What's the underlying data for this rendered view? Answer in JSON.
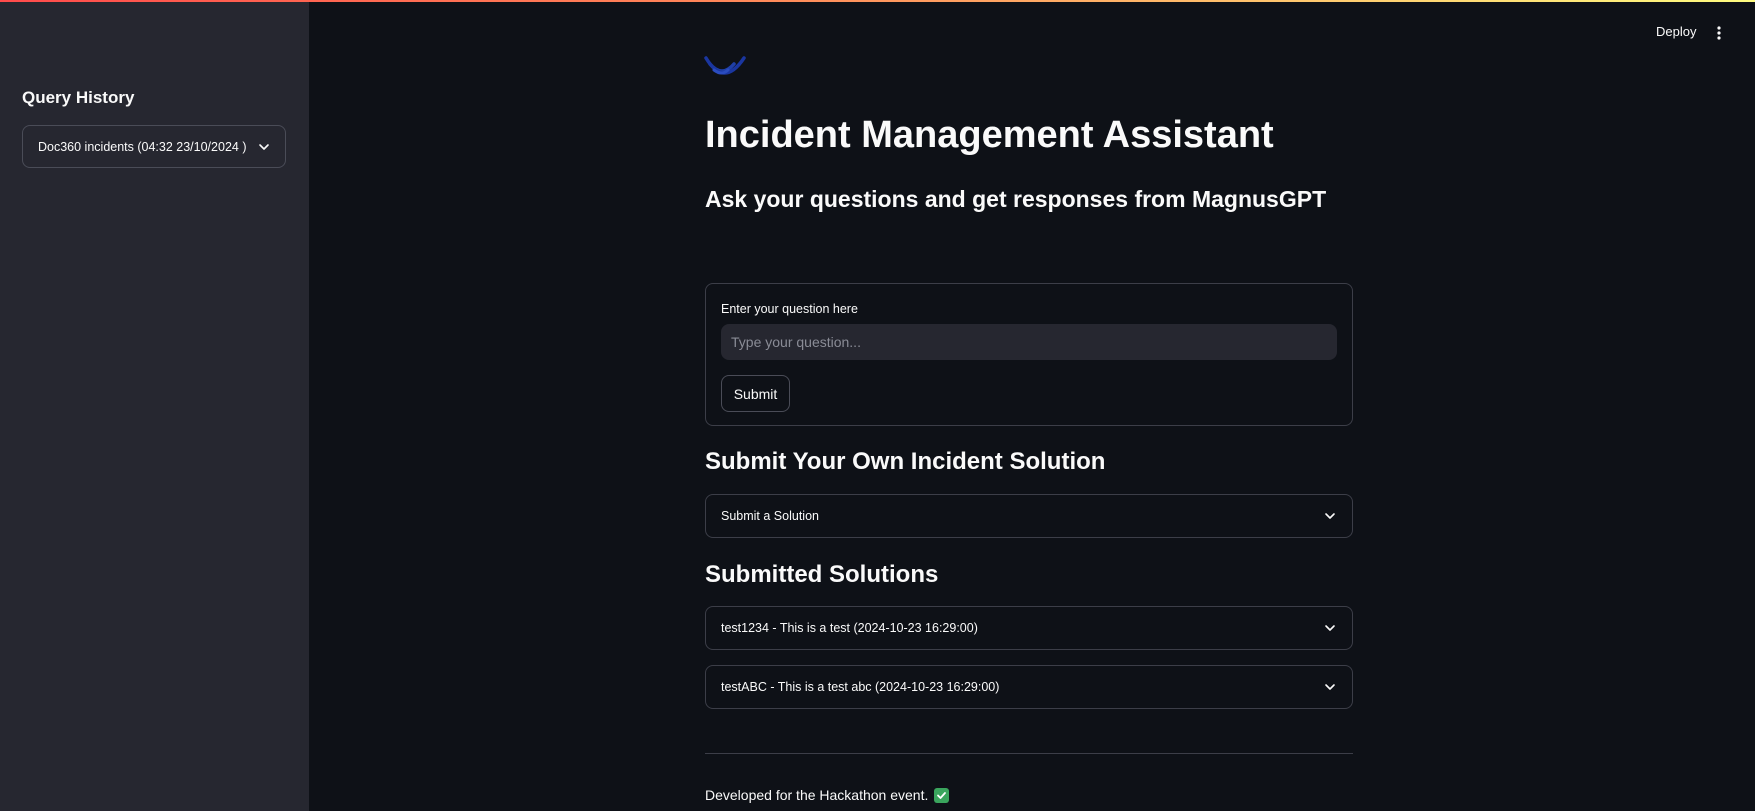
{
  "sidebar": {
    "title": "Query History",
    "select_value": "Doc360 incidents (04:32 23/10/2024 )"
  },
  "header": {
    "deploy_label": "Deploy",
    "menu_icon": "kebab-menu-icon"
  },
  "main": {
    "logo_icon": "wave-logo-icon",
    "title": "Incident Management Assistant",
    "subtitle": "Ask your questions and get responses from MagnusGPT",
    "form": {
      "label": "Enter your question here",
      "placeholder": "Type your question...",
      "value": "",
      "submit_label": "Submit"
    },
    "own_solution": {
      "heading": "Submit Your Own Incident Solution",
      "expander_label": "Submit a Solution"
    },
    "submitted": {
      "heading": "Submitted Solutions",
      "items": [
        {
          "label": "test1234 - This is a test (2024-10-23 16:29:00)"
        },
        {
          "label": "testABC - This is a test abc (2024-10-23 16:29:00)"
        }
      ]
    },
    "footer": {
      "text": "Developed for the Hackathon event.",
      "icon": "check-icon"
    }
  },
  "colors": {
    "background": "#0e1117",
    "sidebar": "#262730",
    "border": "#3c3e48",
    "check": "#3aa55d",
    "accent_gradient": [
      "#ff4b4b",
      "#fffd80"
    ]
  }
}
